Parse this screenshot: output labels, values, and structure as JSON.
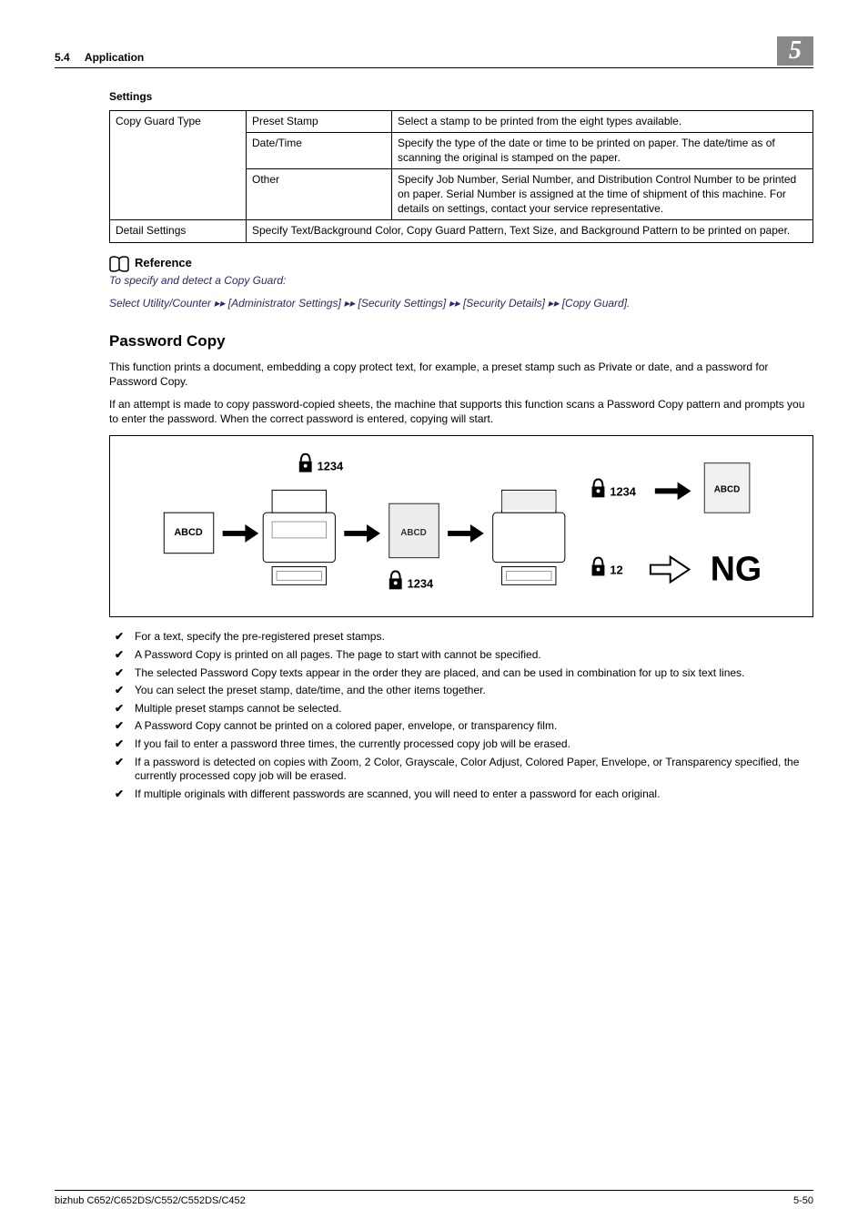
{
  "header": {
    "section_num": "5.4",
    "section_title": "Application",
    "chapter": "5"
  },
  "table": {
    "title": "Settings",
    "r1c1": "Copy Guard Type",
    "r1c2": "Preset Stamp",
    "r1c3": "Select a stamp to be printed from the eight types available.",
    "r2c2": "Date/Time",
    "r2c3": "Specify the type of the date or time to be printed on paper. The date/time as of scanning the original is stamped on the paper.",
    "r3c2": "Other",
    "r3c3": "Specify Job Number, Serial Number, and Distribution Control Number to be printed on paper. Serial Number is assigned at the time of shipment of this machine. For details on settings, contact your service representative.",
    "r4c1": "Detail Settings",
    "r4c2": "Specify Text/Background Color, Copy Guard Pattern, Text Size, and Background Pattern to be printed on paper."
  },
  "reference": {
    "heading": "Reference",
    "line1": "To specify and detect a Copy Guard:",
    "line2": "Select Utility/Counter ▸▸ [Administrator Settings] ▸▸ [Security Settings] ▸▸ [Security Details] ▸▸ [Copy Guard]."
  },
  "section": {
    "title": "Password Copy",
    "p1": "This function prints a document, embedding a copy protect text, for example, a preset stamp such as Private or date, and a password for Password Copy.",
    "p2": "If an attempt is made to copy password-copied sheets, the machine that supports this function scans a Password Copy pattern and prompts you to enter the password. When the correct password is entered, copying will start."
  },
  "diagram": {
    "label_abcd": "ABCD",
    "label_1234": "1234",
    "label_12": "12",
    "label_ng": "NG"
  },
  "bullets": [
    "For a text, specify the pre-registered preset stamps.",
    "A Password Copy is printed on all pages. The page to start with cannot be specified.",
    "The selected Password Copy texts appear in the order they are placed, and can be used in combination for up to six text lines.",
    "You can select the preset stamp, date/time, and the other items together.",
    "Multiple preset stamps cannot be selected.",
    "A Password Copy cannot be printed on a colored paper, envelope, or transparency film.",
    "If you fail to enter a password three times, the currently processed copy job will be erased.",
    "If a password is detected on copies with Zoom, 2 Color, Grayscale, Color Adjust, Colored Paper, Envelope, or Transparency specified, the currently processed copy job will be erased.",
    "If multiple originals with different passwords are scanned, you will need to enter a password for each original."
  ],
  "footer": {
    "model": "bizhub C652/C652DS/C552/C552DS/C452",
    "page": "5-50"
  }
}
